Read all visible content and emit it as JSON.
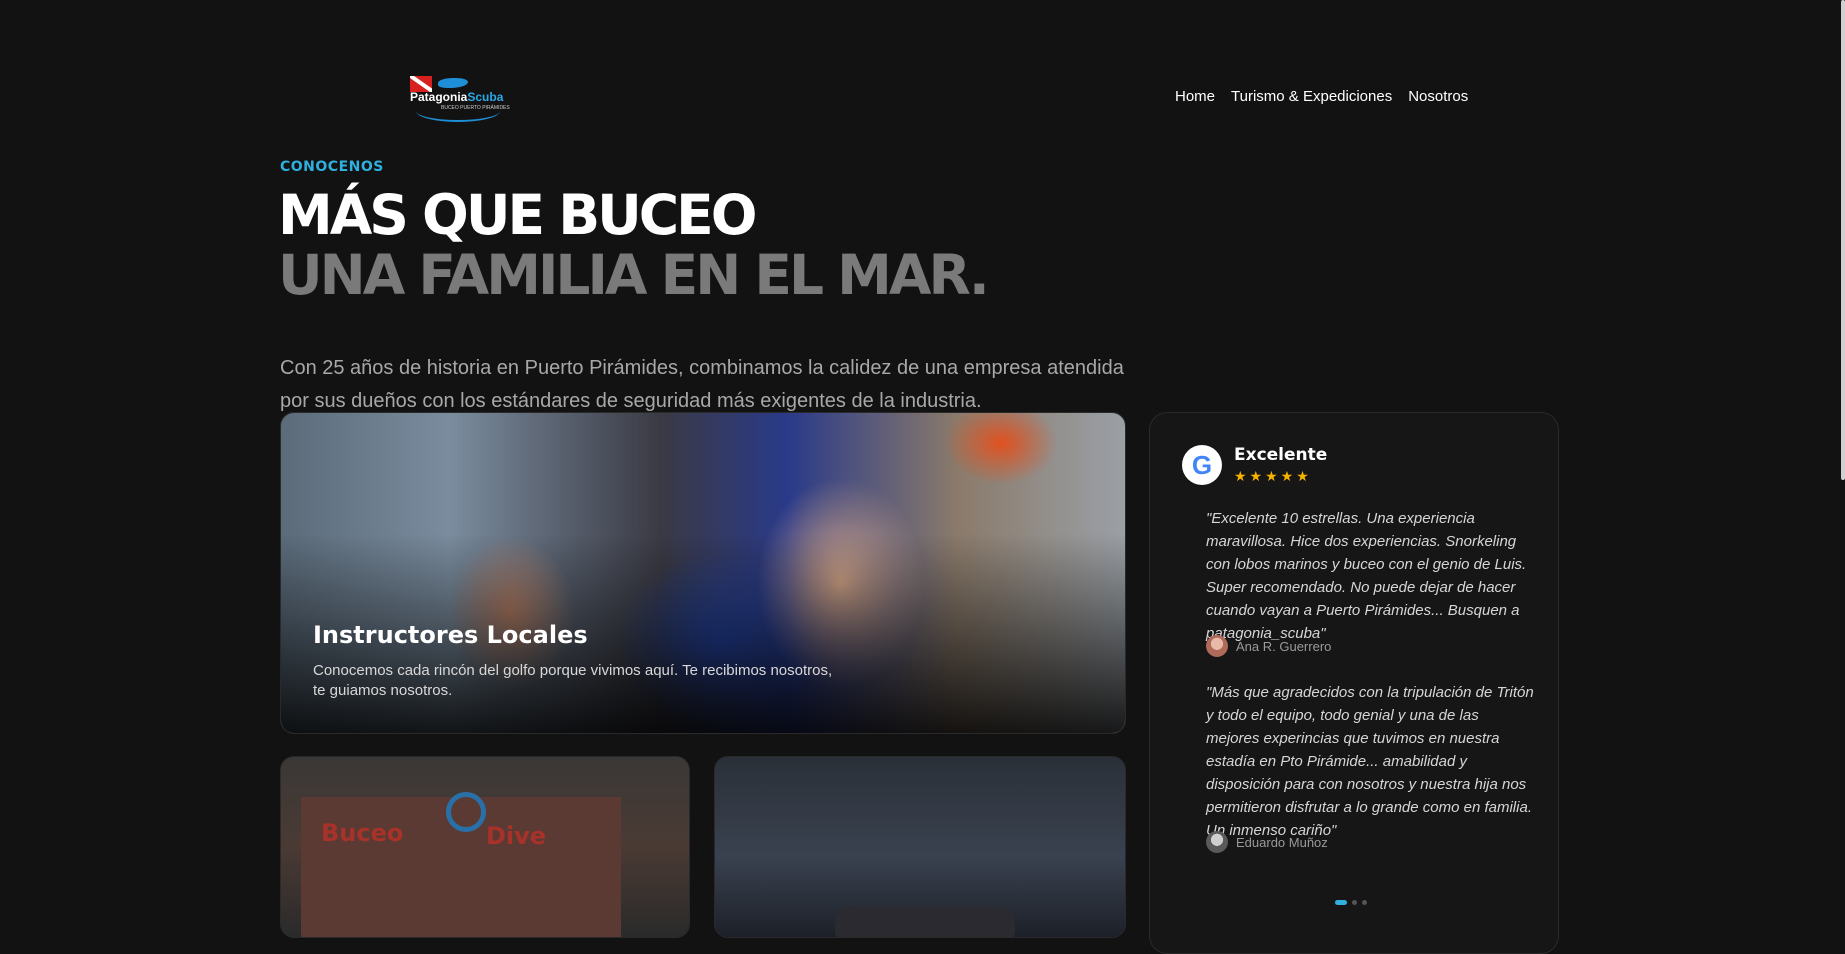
{
  "header": {
    "logo_text_a": "Patagonia",
    "logo_text_b": "Scuba",
    "logo_tagline": "BUCEO PUERTO PIRÁMIDES",
    "nav": [
      "Home",
      "Turismo & Expediciones",
      "Nosotros"
    ]
  },
  "hero": {
    "eyebrow": "CONOCENOS",
    "title_line1": "MÁS QUE BUCEO",
    "title_line2": "UNA FAMILIA EN EL MAR.",
    "lead": "Con 25 años de historia en Puerto Pirámides, combinamos la calidez de una empresa atendida por sus dueños con los estándares de seguridad más exigentes de la industria."
  },
  "cards": {
    "main": {
      "title": "Instructores Locales",
      "description": "Conocemos cada rincón del golfo porque vivimos aquí. Te recibimos nosotros, te guiamos nosotros."
    },
    "photo_a_sign_1": "Buceo",
    "photo_a_sign_2": "Dive"
  },
  "reviews": {
    "logo_letter": "G",
    "title": "Excelente",
    "stars": "★★★★★",
    "items": [
      {
        "text": "\"Excelente 10 estrellas. Una experiencia maravillosa. Hice dos experiencias. Snorkeling con lobos marinos y buceo con el genio de Luis. Super recomendado. No puede dejar de hacer cuando vayan a Puerto Pirámides... Busquen a patagonia_scuba\"",
        "author": "Ana R. Guerrero"
      },
      {
        "text": "\"Más que agradecidos con la tripulación de Tritón y todo el equipo, todo genial y una de las mejores experincias que tuvimos en nuestra estadía en Pto Pirámide... amabilidad y disposición para con nosotros y nuestra hija nos permitieron disfrutar a lo grande como en familia. Un inmenso cariño\"",
        "author": "Eduardo Muñoz"
      }
    ],
    "page_count": 3,
    "active_page": 1
  },
  "colors": {
    "background": "#121212",
    "accent": "#2fb0e0",
    "star": "#f5b301"
  }
}
